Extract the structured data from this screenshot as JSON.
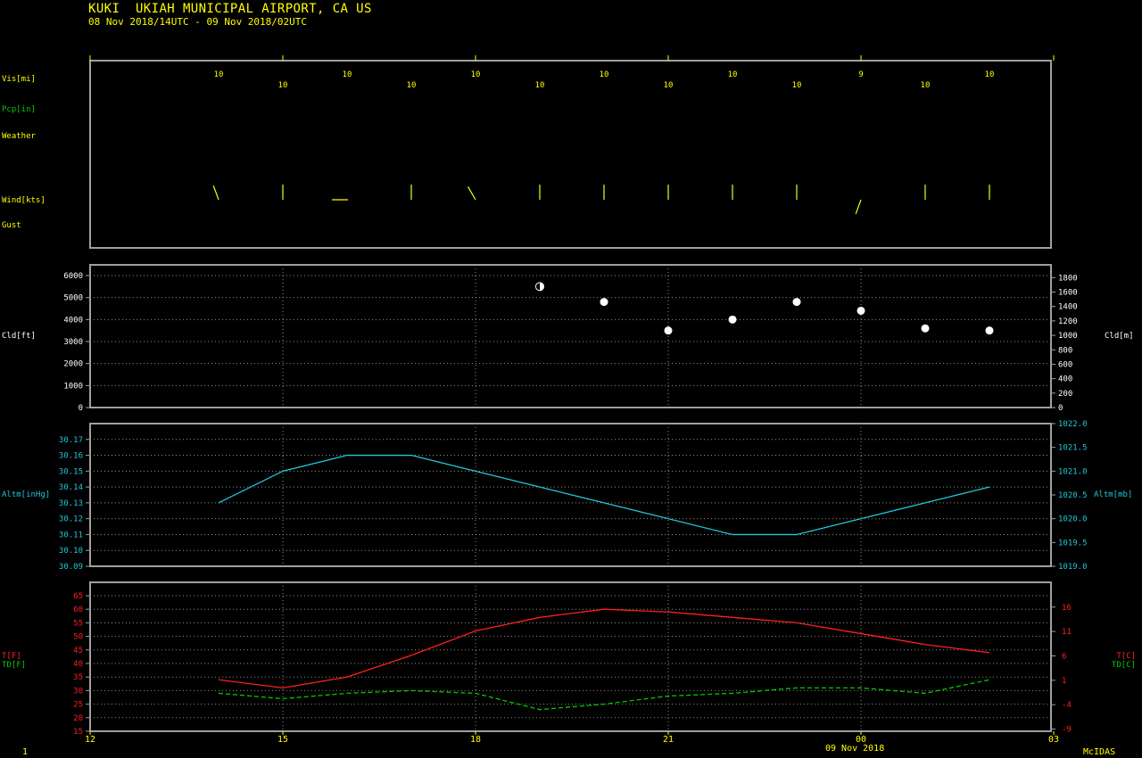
{
  "header": {
    "title": "KUKI  UKIAH MUNICIPAL AIRPORT, CA US",
    "subtitle": "08 Nov 2018/14UTC - 09 Nov 2018/02UTC"
  },
  "footer": {
    "left": "1",
    "date": "09 Nov 2018",
    "brand": "McIDAS"
  },
  "colors": {
    "background": "#000000",
    "frame": "#a0a0a0",
    "grid": "#909090",
    "yellow": "#ffff00",
    "green": "#00cc00",
    "cyan": "#22c8d8",
    "red": "#ff2020",
    "white": "#ffffff"
  },
  "chart_data": [
    {
      "type": "table",
      "panel": "surface",
      "row_labels": {
        "vis": "Vis[mi]",
        "pcp": "Pcp[in]",
        "weather": "Weather",
        "wind": "Wind[kts]",
        "gust": "Gust"
      },
      "hours": [
        14,
        15,
        16,
        17,
        18,
        19,
        20,
        21,
        22,
        23,
        0,
        1,
        2
      ],
      "visibility": [
        "10",
        "10",
        "10",
        "10",
        "10",
        "10",
        "10",
        "10",
        "10",
        "10",
        "9",
        "10",
        "10"
      ],
      "wind_direction_deg": [
        340,
        0,
        270,
        0,
        330,
        0,
        0,
        0,
        0,
        0,
        200,
        0,
        0
      ]
    },
    {
      "type": "scatter",
      "panel": "cloud",
      "ylabel": "Cld[ft]",
      "y2label": "Cld[m]",
      "yticks": [
        "0",
        "1000",
        "2000",
        "3000",
        "4000",
        "5000",
        "6000"
      ],
      "y2ticks": [
        "0",
        "200",
        "400",
        "600",
        "800",
        "1000",
        "1200",
        "1400",
        "1600",
        "1800"
      ],
      "ylim": [
        0,
        6000
      ],
      "x": [
        19,
        20,
        21,
        22,
        23,
        0,
        1,
        2
      ],
      "y": [
        5500,
        4800,
        3500,
        4000,
        4800,
        4400,
        3600,
        3500
      ],
      "cover": [
        "scattered",
        "overcast",
        "overcast",
        "overcast",
        "overcast",
        "overcast",
        "overcast",
        "overcast"
      ]
    },
    {
      "type": "line",
      "panel": "altimeter",
      "ylabel": "Altm[inHg]",
      "y2label": "Altm[mb]",
      "yticks": [
        "30.09",
        "30.10",
        "30.11",
        "30.12",
        "30.13",
        "30.14",
        "30.15",
        "30.16",
        "30.17"
      ],
      "y2ticks": [
        "1019.0",
        "1019.5",
        "1020.0",
        "1020.5",
        "1021.0",
        "1021.5",
        "1022.0"
      ],
      "ylim": [
        30.09,
        30.18
      ],
      "x": [
        14,
        15,
        16,
        17,
        18,
        19,
        20,
        21,
        22,
        23,
        0,
        1,
        2
      ],
      "y": [
        30.13,
        30.15,
        30.16,
        30.16,
        30.15,
        30.14,
        30.13,
        30.12,
        30.11,
        30.11,
        30.12,
        30.13,
        30.14
      ]
    },
    {
      "type": "line",
      "panel": "temperature",
      "ylabel_t": "T[F]",
      "ylabel_td": "TD[F]",
      "y2label_t": "T[C]",
      "y2label_td": "TD[C]",
      "yticks": [
        "15",
        "20",
        "25",
        "30",
        "35",
        "40",
        "45",
        "50",
        "55",
        "60",
        "65"
      ],
      "y2ticks": [
        "-9",
        "-4",
        "1",
        "6",
        "11",
        "16"
      ],
      "ylim": [
        15,
        68
      ],
      "x": [
        14,
        15,
        16,
        17,
        18,
        19,
        20,
        21,
        22,
        23,
        0,
        1,
        2
      ],
      "series": [
        {
          "name": "T[F]",
          "values": [
            34,
            31,
            35,
            43,
            52,
            57,
            60,
            59,
            57,
            55,
            51,
            47,
            44
          ]
        },
        {
          "name": "TD[F]",
          "values": [
            29,
            27,
            29,
            30,
            29,
            23,
            25,
            28,
            29,
            31,
            31,
            29,
            34
          ]
        }
      ],
      "xticks": [
        "12",
        "15",
        "18",
        "21",
        "00",
        "03"
      ]
    }
  ]
}
